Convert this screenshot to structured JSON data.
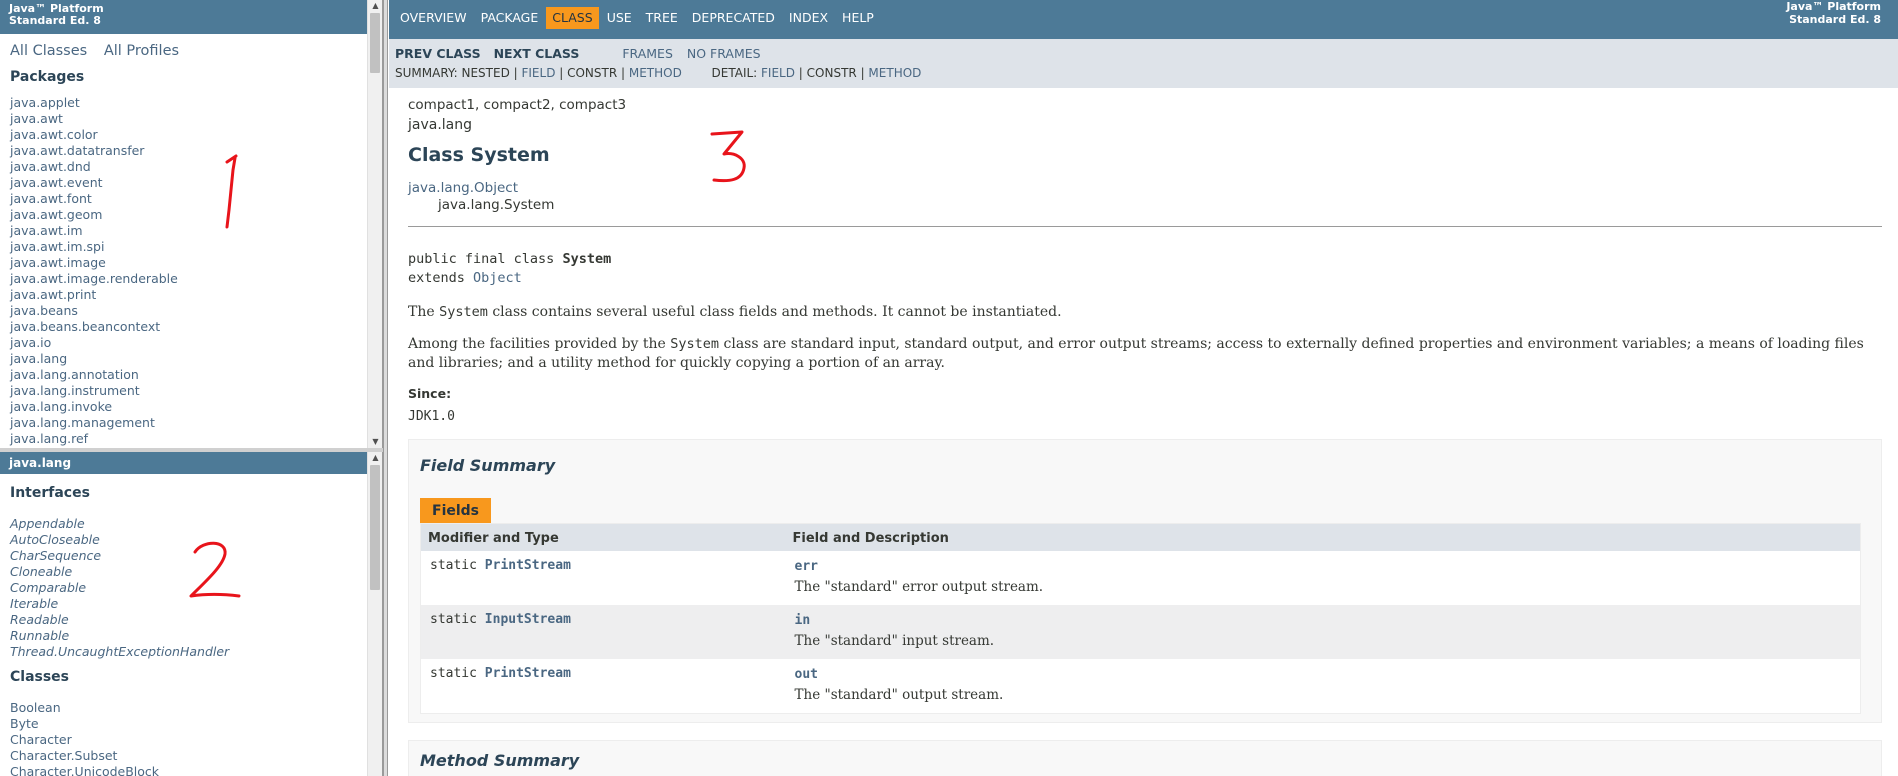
{
  "packages_frame": {
    "header_line1": "Java™ Platform",
    "header_line2": "Standard Ed. 8",
    "all_classes": "All Classes",
    "all_profiles": "All Profiles",
    "packages_heading": "Packages",
    "packages": [
      "java.applet",
      "java.awt",
      "java.awt.color",
      "java.awt.datatransfer",
      "java.awt.dnd",
      "java.awt.event",
      "java.awt.font",
      "java.awt.geom",
      "java.awt.im",
      "java.awt.im.spi",
      "java.awt.image",
      "java.awt.image.renderable",
      "java.awt.print",
      "java.beans",
      "java.beans.beancontext",
      "java.io",
      "java.lang",
      "java.lang.annotation",
      "java.lang.instrument",
      "java.lang.invoke",
      "java.lang.management",
      "java.lang.ref"
    ]
  },
  "classes_frame": {
    "package_title": "java.lang",
    "interfaces_heading": "Interfaces",
    "interfaces": [
      "Appendable",
      "AutoCloseable",
      "CharSequence",
      "Cloneable",
      "Comparable",
      "Iterable",
      "Readable",
      "Runnable",
      "Thread.UncaughtExceptionHandler"
    ],
    "classes_heading": "Classes",
    "classes": [
      "Boolean",
      "Byte",
      "Character",
      "Character.Subset",
      "Character.UnicodeBlock"
    ]
  },
  "main_frame": {
    "nav": [
      "OVERVIEW",
      "PACKAGE",
      "CLASS",
      "USE",
      "TREE",
      "DEPRECATED",
      "INDEX",
      "HELP"
    ],
    "nav_active": "CLASS",
    "about_line1": "Java™ Platform",
    "about_line2": "Standard Ed. 8",
    "prev_class": "PREV CLASS",
    "next_class": "NEXT CLASS",
    "frames": "FRAMES",
    "no_frames": "NO FRAMES",
    "summary_label": "SUMMARY: ",
    "summary_nested": "NESTED",
    "summary_field": "FIELD",
    "summary_constr": "CONSTR",
    "summary_method": "METHOD",
    "detail_label": "DETAIL: ",
    "detail_field": "FIELD",
    "detail_constr": "CONSTR",
    "detail_method": "METHOD",
    "sep": " | ",
    "profiles": "compact1, compact2, compact3",
    "package": "java.lang",
    "class_title": "Class System",
    "inherit_base": "java.lang.Object",
    "inherit_sub": "java.lang.System",
    "sig_prefix": "public final class ",
    "sig_name": "System",
    "sig_extends": "extends ",
    "sig_extends_type": "Object",
    "desc1_pre": "The ",
    "desc1_code": "System",
    "desc1_post": " class contains several useful class fields and methods. It cannot be instantiated.",
    "desc2_pre": "Among the facilities provided by the ",
    "desc2_code": "System",
    "desc2_post": " class are standard input, standard output, and error output streams; access to externally defined properties and environment variables; a means of loading files and libraries; and a utility method for quickly copying a portion of an array.",
    "since_label": "Since:",
    "since_value": "JDK1.0",
    "field_summary_title": "Field Summary",
    "fields_caption": "Fields",
    "col_modifier": "Modifier and Type",
    "col_field": "Field and Description",
    "fields": [
      {
        "modifier": "static ",
        "type": "PrintStream",
        "name": "err",
        "desc": "The \"standard\" error output stream."
      },
      {
        "modifier": "static ",
        "type": "InputStream",
        "name": "in",
        "desc": "The \"standard\" input stream."
      },
      {
        "modifier": "static ",
        "type": "PrintStream",
        "name": "out",
        "desc": "The \"standard\" output stream."
      }
    ],
    "method_summary_title": "Method Summary"
  },
  "annotations": {
    "label1": "1",
    "label2": "2",
    "label3": "3",
    "color": "#e8141b"
  }
}
